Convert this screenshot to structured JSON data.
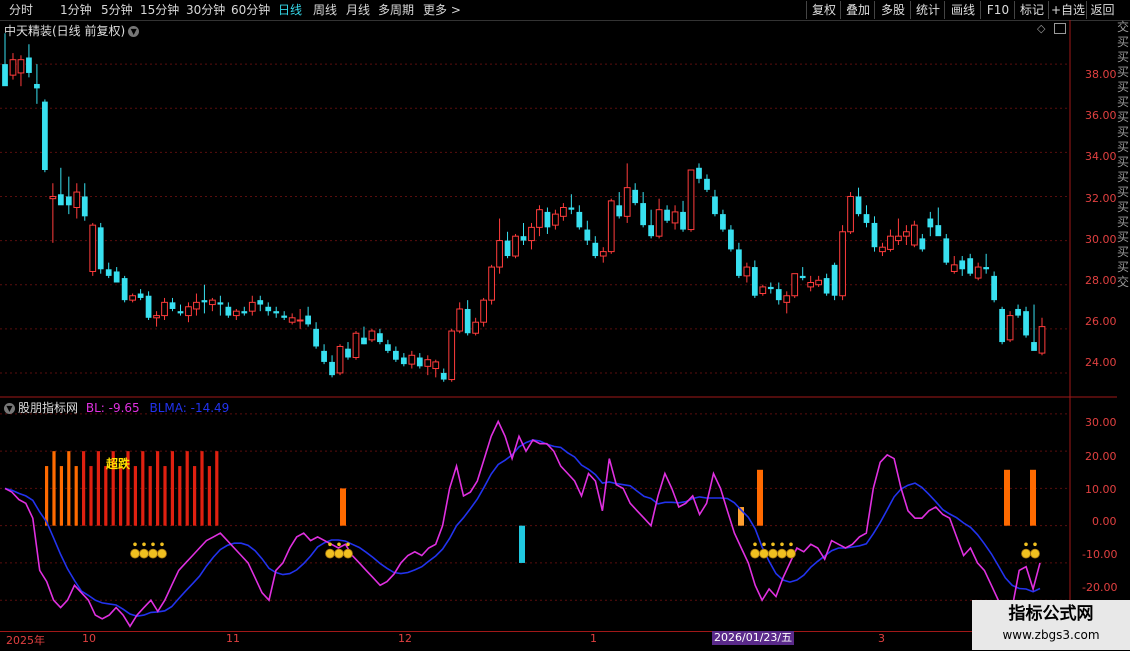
{
  "toolbar": {
    "periods": [
      "分时",
      "1分钟",
      "5分钟",
      "15分钟",
      "30分钟",
      "60分钟",
      "日线",
      "周线",
      "月线",
      "多周期",
      "更多"
    ],
    "active_period": "日线",
    "more_arrow": ">",
    "right_buttons": [
      "复权",
      "叠加",
      "多股",
      "统计",
      "画线",
      "F10",
      "标记",
      "+自选",
      "返回"
    ]
  },
  "main_chart": {
    "title": "中天精装(日线 前复权)",
    "price_ticks": [
      "38.00",
      "36.00",
      "34.00",
      "32.00",
      "30.00",
      "28.00",
      "26.00",
      "24.00"
    ],
    "ylim": [
      23.0,
      40.0
    ]
  },
  "indicator": {
    "name": "股朋指标网",
    "bl_label": "BL: -9.65",
    "blma_label": "BLMA: -14.49",
    "ticks": [
      "30.00",
      "20.00",
      "10.00",
      "0.00",
      "-10.00",
      "-20.00"
    ],
    "ylim": [
      -28,
      34
    ],
    "annotation": "超跌",
    "colors": {
      "bl": "#e030e0",
      "blma": "#2233ee",
      "bar_red": "#e02010",
      "bar_orange": "#ff6a00",
      "bar_light": "#ffa030",
      "bar_cyan": "#20c8e0"
    }
  },
  "date_axis": {
    "labels": [
      "2025年",
      "10",
      "11",
      "12",
      "1",
      "3"
    ],
    "cursor_date": "2026/01/23/五"
  },
  "right_strip_chars": "交买买买买买买买买买买买买买买买买交",
  "watermark": {
    "line1": "指标公式网",
    "line2": "www.zbgs3.com"
  },
  "chart_data": {
    "type": "candlestick",
    "title": "中天精装(日线 前复权)",
    "candles": [
      [
        38.0,
        39.4,
        37.1,
        37.0,
        "down"
      ],
      [
        38.2,
        38.5,
        37.3,
        37.5,
        "up"
      ],
      [
        37.6,
        38.4,
        37.0,
        38.2,
        "up"
      ],
      [
        38.3,
        38.9,
        37.4,
        37.6,
        "down"
      ],
      [
        37.1,
        38.0,
        36.2,
        36.9,
        "down"
      ],
      [
        36.3,
        36.4,
        33.1,
        33.2,
        "down"
      ],
      [
        31.9,
        32.6,
        29.9,
        32.0,
        "up"
      ],
      [
        32.1,
        33.3,
        31.7,
        31.6,
        "down"
      ],
      [
        32.0,
        32.9,
        31.2,
        31.6,
        "down"
      ],
      [
        31.5,
        32.6,
        31.0,
        32.2,
        "up"
      ],
      [
        32.0,
        32.6,
        30.9,
        31.1,
        "down"
      ],
      [
        28.6,
        30.8,
        28.4,
        30.7,
        "up"
      ],
      [
        30.6,
        30.8,
        28.5,
        28.7,
        "down"
      ],
      [
        28.7,
        29.0,
        28.3,
        28.4,
        "down"
      ],
      [
        28.6,
        28.8,
        28.1,
        28.1,
        "down"
      ],
      [
        28.3,
        28.4,
        27.2,
        27.3,
        "down"
      ],
      [
        27.3,
        27.6,
        27.2,
        27.5,
        "up"
      ],
      [
        27.6,
        27.8,
        27.3,
        27.4,
        "down"
      ],
      [
        27.5,
        27.7,
        26.4,
        26.5,
        "down"
      ],
      [
        26.5,
        26.8,
        26.1,
        26.6,
        "up"
      ],
      [
        26.6,
        27.4,
        26.4,
        27.2,
        "up"
      ],
      [
        27.2,
        27.4,
        26.8,
        26.9,
        "down"
      ],
      [
        26.8,
        27.1,
        26.6,
        26.7,
        "down"
      ],
      [
        26.6,
        27.2,
        26.3,
        27.0,
        "up"
      ],
      [
        26.9,
        27.6,
        26.6,
        27.2,
        "up"
      ],
      [
        27.2,
        28.0,
        26.7,
        27.3,
        "down"
      ],
      [
        27.3,
        27.4,
        26.8,
        27.1,
        "up"
      ],
      [
        27.1,
        27.5,
        26.6,
        27.2,
        "down"
      ],
      [
        27.0,
        27.2,
        26.5,
        26.6,
        "down"
      ],
      [
        26.6,
        26.9,
        26.4,
        26.8,
        "up"
      ],
      [
        26.8,
        27.0,
        26.6,
        26.7,
        "down"
      ],
      [
        26.8,
        27.5,
        26.6,
        27.2,
        "up"
      ],
      [
        27.3,
        27.5,
        26.8,
        27.1,
        "down"
      ],
      [
        27.0,
        27.2,
        26.6,
        26.8,
        "down"
      ],
      [
        26.8,
        27.0,
        26.5,
        26.7,
        "down"
      ],
      [
        26.6,
        26.8,
        26.4,
        26.5,
        "down"
      ],
      [
        26.5,
        26.7,
        26.2,
        26.3,
        "up"
      ],
      [
        26.4,
        26.9,
        26.0,
        26.4,
        "up"
      ],
      [
        26.6,
        27.0,
        26.1,
        26.2,
        "down"
      ],
      [
        26.0,
        26.3,
        25.1,
        25.2,
        "down"
      ],
      [
        25.0,
        25.3,
        24.4,
        24.5,
        "down"
      ],
      [
        24.5,
        24.8,
        23.8,
        23.9,
        "down"
      ],
      [
        24.0,
        25.3,
        23.9,
        25.2,
        "up"
      ],
      [
        25.1,
        25.4,
        24.6,
        24.7,
        "down"
      ],
      [
        24.7,
        25.9,
        24.6,
        25.8,
        "up"
      ],
      [
        25.6,
        26.1,
        25.3,
        25.3,
        "down"
      ],
      [
        25.5,
        26.0,
        25.4,
        25.9,
        "up"
      ],
      [
        25.8,
        26.0,
        25.3,
        25.4,
        "down"
      ],
      [
        25.3,
        25.5,
        24.9,
        25.0,
        "down"
      ],
      [
        25.0,
        25.2,
        24.5,
        24.6,
        "down"
      ],
      [
        24.7,
        24.9,
        24.3,
        24.4,
        "down"
      ],
      [
        24.4,
        25.0,
        24.2,
        24.8,
        "up"
      ],
      [
        24.7,
        24.9,
        24.2,
        24.3,
        "down"
      ],
      [
        24.3,
        24.8,
        23.9,
        24.6,
        "up"
      ],
      [
        24.5,
        24.6,
        23.8,
        24.2,
        "up"
      ],
      [
        24.0,
        24.2,
        23.6,
        23.7,
        "down"
      ],
      [
        23.7,
        26.0,
        23.6,
        25.9,
        "up"
      ],
      [
        25.9,
        27.2,
        25.8,
        26.9,
        "up"
      ],
      [
        26.9,
        27.3,
        25.7,
        25.8,
        "down"
      ],
      [
        25.8,
        26.5,
        25.7,
        26.3,
        "up"
      ],
      [
        26.3,
        27.4,
        26.1,
        27.3,
        "up"
      ],
      [
        27.3,
        28.9,
        27.1,
        28.8,
        "up"
      ],
      [
        28.8,
        31.0,
        28.5,
        30.0,
        "up"
      ],
      [
        30.0,
        30.4,
        29.2,
        29.3,
        "down"
      ],
      [
        29.3,
        30.3,
        29.2,
        30.2,
        "up"
      ],
      [
        30.2,
        30.8,
        29.8,
        30.0,
        "down"
      ],
      [
        30.0,
        30.8,
        29.6,
        30.6,
        "up"
      ],
      [
        30.6,
        31.6,
        30.2,
        31.4,
        "up"
      ],
      [
        31.3,
        31.5,
        30.3,
        30.6,
        "down"
      ],
      [
        30.7,
        31.4,
        30.5,
        31.2,
        "up"
      ],
      [
        31.1,
        31.7,
        30.9,
        31.5,
        "up"
      ],
      [
        31.5,
        32.1,
        31.2,
        31.4,
        "down"
      ],
      [
        31.3,
        31.6,
        30.5,
        30.6,
        "down"
      ],
      [
        30.5,
        30.9,
        29.8,
        30.0,
        "down"
      ],
      [
        29.9,
        30.2,
        29.2,
        29.3,
        "down"
      ],
      [
        29.3,
        29.7,
        29.0,
        29.5,
        "up"
      ],
      [
        29.5,
        31.9,
        29.4,
        31.8,
        "up"
      ],
      [
        31.6,
        32.2,
        31.0,
        31.1,
        "down"
      ],
      [
        31.1,
        33.5,
        30.8,
        32.4,
        "up"
      ],
      [
        32.3,
        32.6,
        31.6,
        31.7,
        "down"
      ],
      [
        31.7,
        32.2,
        30.6,
        30.7,
        "down"
      ],
      [
        30.7,
        31.4,
        30.1,
        30.2,
        "down"
      ],
      [
        30.2,
        31.9,
        30.1,
        31.4,
        "up"
      ],
      [
        31.4,
        31.6,
        30.8,
        30.9,
        "down"
      ],
      [
        30.8,
        31.6,
        30.5,
        31.3,
        "up"
      ],
      [
        31.3,
        31.8,
        30.4,
        30.5,
        "down"
      ],
      [
        30.5,
        33.2,
        30.4,
        33.2,
        "up"
      ],
      [
        33.3,
        33.5,
        32.6,
        32.8,
        "down"
      ],
      [
        32.8,
        33.0,
        32.2,
        32.3,
        "down"
      ],
      [
        32.0,
        32.3,
        31.1,
        31.2,
        "down"
      ],
      [
        31.2,
        31.4,
        30.4,
        30.5,
        "down"
      ],
      [
        30.5,
        30.7,
        29.5,
        29.6,
        "down"
      ],
      [
        29.6,
        29.9,
        28.3,
        28.4,
        "down"
      ],
      [
        28.4,
        29.0,
        28.1,
        28.8,
        "up"
      ],
      [
        28.8,
        29.1,
        27.4,
        27.5,
        "down"
      ],
      [
        27.6,
        28.0,
        27.5,
        27.9,
        "up"
      ],
      [
        27.9,
        28.1,
        27.6,
        27.8,
        "down"
      ],
      [
        27.8,
        28.1,
        27.1,
        27.3,
        "down"
      ],
      [
        27.2,
        27.7,
        26.7,
        27.5,
        "up"
      ],
      [
        27.5,
        28.5,
        27.4,
        28.5,
        "up"
      ],
      [
        28.4,
        28.8,
        28.2,
        28.3,
        "down"
      ],
      [
        28.1,
        28.4,
        27.7,
        27.9,
        "up"
      ],
      [
        28.0,
        28.4,
        27.9,
        28.2,
        "up"
      ],
      [
        28.3,
        28.5,
        27.5,
        27.6,
        "down"
      ],
      [
        27.5,
        29.0,
        27.3,
        28.9,
        "down"
      ],
      [
        27.5,
        30.7,
        27.3,
        30.4,
        "up"
      ],
      [
        30.4,
        32.2,
        30.3,
        32.0,
        "up"
      ],
      [
        32.0,
        32.4,
        31.1,
        31.2,
        "down"
      ],
      [
        31.2,
        31.6,
        30.6,
        30.8,
        "down"
      ],
      [
        30.8,
        31.1,
        29.5,
        29.7,
        "down"
      ],
      [
        29.7,
        29.9,
        29.3,
        29.5,
        "up"
      ],
      [
        29.6,
        30.5,
        29.5,
        30.2,
        "up"
      ],
      [
        30.2,
        31.0,
        29.8,
        30.0,
        "up"
      ],
      [
        30.4,
        30.7,
        29.8,
        30.2,
        "up"
      ],
      [
        30.7,
        30.9,
        29.7,
        29.8,
        "up"
      ],
      [
        29.6,
        30.3,
        29.5,
        30.1,
        "down"
      ],
      [
        30.6,
        31.3,
        30.2,
        31.0,
        "down"
      ],
      [
        30.7,
        31.5,
        30.4,
        30.2,
        "down"
      ],
      [
        30.1,
        30.3,
        28.9,
        29.0,
        "down"
      ],
      [
        28.9,
        29.3,
        28.5,
        28.6,
        "up"
      ],
      [
        28.7,
        29.3,
        28.4,
        29.1,
        "down"
      ],
      [
        29.2,
        29.4,
        28.4,
        28.5,
        "down"
      ],
      [
        28.3,
        29.0,
        28.2,
        28.8,
        "up"
      ],
      [
        28.7,
        29.4,
        28.5,
        28.8,
        "down"
      ],
      [
        28.4,
        28.6,
        27.2,
        27.3,
        "down"
      ],
      [
        26.9,
        27.0,
        25.3,
        25.4,
        "down"
      ],
      [
        25.5,
        26.8,
        25.4,
        26.6,
        "up"
      ],
      [
        26.6,
        27.1,
        26.5,
        26.9,
        "down"
      ],
      [
        26.8,
        27.0,
        25.6,
        25.7,
        "down"
      ],
      [
        25.4,
        27.1,
        25.2,
        25.0,
        "down"
      ],
      [
        26.1,
        26.5,
        24.8,
        24.9,
        "up"
      ]
    ],
    "bl_series": [
      10,
      9,
      7,
      6,
      2,
      -12,
      -15,
      -20,
      -22,
      -20,
      -16,
      -18,
      -20,
      -24,
      -25,
      -24,
      -22,
      -24,
      -27,
      -24,
      -22,
      -20,
      -23,
      -20,
      -16,
      -12,
      -10,
      -8,
      -6,
      -4,
      -3,
      -2,
      -4,
      -6,
      -8,
      -10,
      -14,
      -18,
      -20,
      -12,
      -10,
      -6,
      -3,
      -2,
      -4,
      -3,
      -4,
      -5,
      -6,
      -5,
      -8,
      -10,
      -12,
      -14,
      -16,
      -15,
      -13,
      -10,
      -8,
      -7,
      -8,
      -6,
      -5,
      0,
      10,
      16,
      8,
      9,
      12,
      18,
      24,
      28,
      24,
      18,
      24,
      20,
      23,
      22,
      22,
      20,
      16,
      14,
      12,
      8,
      14,
      12,
      4,
      18,
      11,
      10,
      6,
      4,
      2,
      0,
      8,
      14,
      10,
      5,
      6,
      8,
      3,
      6,
      14,
      10,
      4,
      -2,
      -6,
      -10,
      -16,
      -20,
      -17,
      -19,
      -14,
      -10,
      -6,
      -7,
      -5,
      -6,
      -9,
      -4,
      -5,
      -6,
      -5,
      -3,
      -2,
      10,
      17,
      19,
      18,
      10,
      4,
      2,
      2,
      4,
      5,
      3,
      2,
      -3,
      -8,
      -6,
      -10,
      -12,
      -16,
      -20,
      -26,
      -22,
      -12,
      -11,
      -17,
      -10
    ]
  }
}
